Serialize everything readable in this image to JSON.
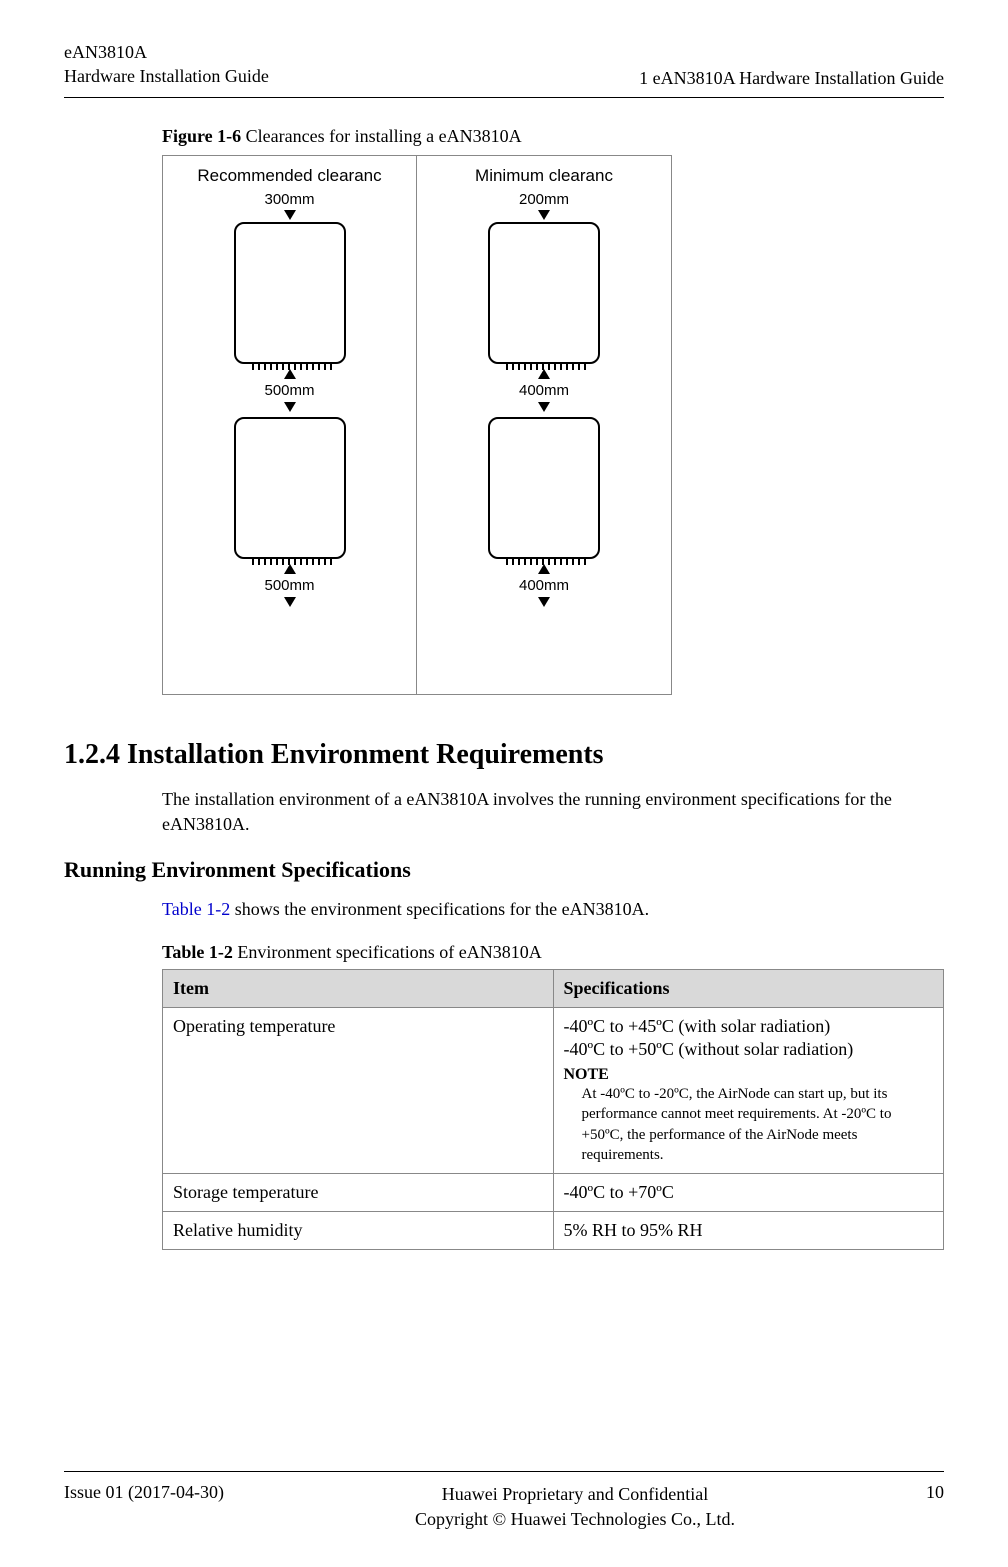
{
  "header": {
    "product": "eAN3810A",
    "doc_title": "Hardware Installation Guide",
    "section_ref": "1 eAN3810A Hardware Installation Guide"
  },
  "figure": {
    "number": "Figure 1-6",
    "caption": "Clearances for installing a eAN3810A",
    "left_title": "Recommended clearanc",
    "right_title": "Minimum clearanc",
    "left_top": "300mm",
    "left_mid": "500mm",
    "left_bot": "500mm",
    "right_top": "200mm",
    "right_mid": "400mm",
    "right_bot": "400mm"
  },
  "section": {
    "heading": "1.2.4 Installation Environment Requirements",
    "body": "The installation environment of a eAN3810A involves the running environment specifications for the eAN3810A."
  },
  "subsection": {
    "heading": "Running Environment Specifications",
    "intro_pre": "",
    "intro_link": "Table 1-2",
    "intro_post": " shows the environment specifications for the eAN3810A."
  },
  "table": {
    "number": "Table 1-2",
    "caption": "Environment specifications of eAN3810A",
    "col1": "Item",
    "col2": "Specifications",
    "rows": [
      {
        "item": "Operating temperature",
        "spec_line1": "-40ºC to +45ºC (with solar radiation)",
        "spec_line2": "-40ºC to +50ºC (without solar radiation)",
        "note_label": "NOTE",
        "note_text": "At -40ºC to -20ºC, the AirNode can start up, but its performance cannot meet requirements. At -20ºC to +50ºC, the performance of the AirNode meets requirements."
      },
      {
        "item": "Storage temperature",
        "spec_line1": "-40ºC to +70ºC"
      },
      {
        "item": "Relative humidity",
        "spec_line1": "5% RH to 95% RH"
      }
    ]
  },
  "footer": {
    "issue": "Issue 01 (2017-04-30)",
    "center1": "Huawei Proprietary and Confidential",
    "center2": "Copyright © Huawei Technologies Co., Ltd.",
    "page": "10"
  }
}
